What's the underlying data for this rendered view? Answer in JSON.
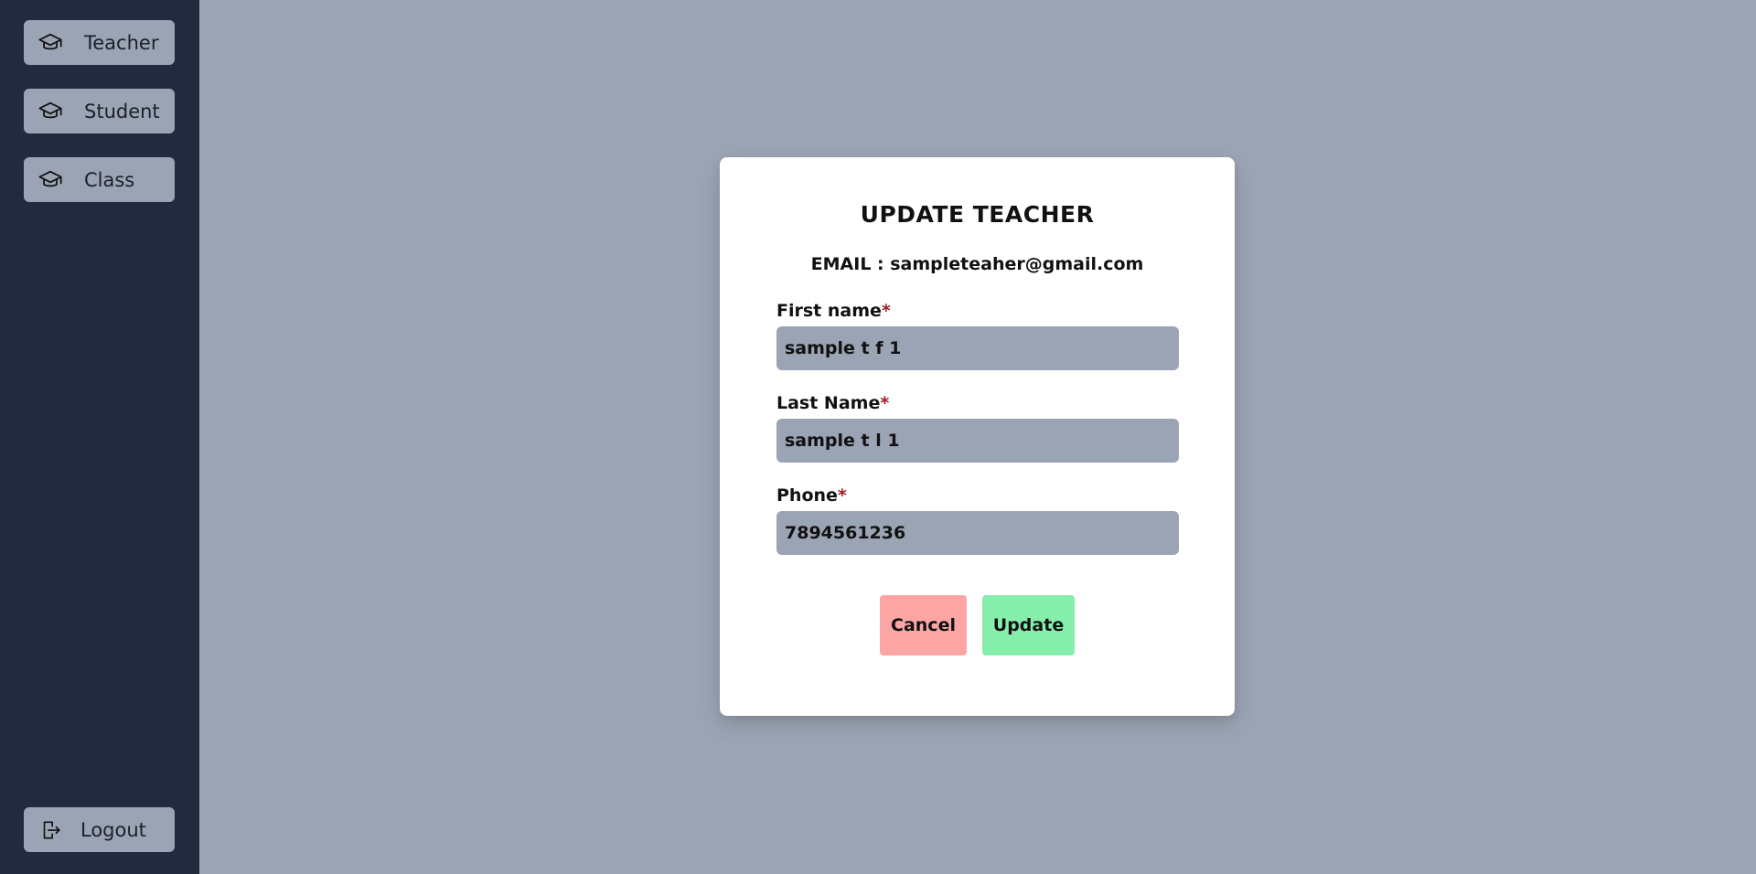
{
  "sidebar": {
    "items": [
      {
        "label": "Teacher",
        "icon": "graduation-cap-icon"
      },
      {
        "label": "Student",
        "icon": "graduation-cap-icon"
      },
      {
        "label": "Class",
        "icon": "graduation-cap-icon"
      }
    ],
    "logout": {
      "label": "Logout",
      "icon": "logout-icon"
    }
  },
  "modal": {
    "title": "UPDATE TEACHER",
    "email_line": "EMAIL : sampleteaher@gmail.com",
    "fields": {
      "first_name": {
        "label": "First name",
        "required_mark": "*",
        "value": "sample t f 1"
      },
      "last_name": {
        "label": "Last Name",
        "required_mark": "*",
        "value": "sample t l 1"
      },
      "phone": {
        "label": "Phone",
        "required_mark": "*",
        "value": "7894561236"
      }
    },
    "buttons": {
      "cancel": "Cancel",
      "update": "Update"
    }
  },
  "colors": {
    "sidebar_bg": "#232a40",
    "main_bg": "#9ba4b4",
    "cancel_bg": "#fca5a5",
    "update_bg": "#86efac",
    "required": "#9b1c1c"
  }
}
